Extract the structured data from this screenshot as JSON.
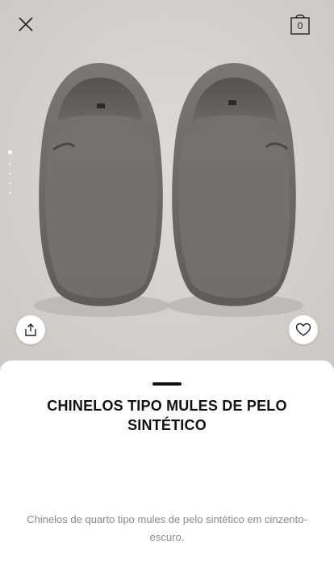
{
  "header": {
    "close_icon": "close-icon",
    "bag_icon": "shopping-bag-icon",
    "bag_count": "0"
  },
  "gallery": {
    "image_subject": "grey faux fur mule slippers",
    "dot_count": 5,
    "active_dot_index": 0
  },
  "actions": {
    "share_icon": "share-icon",
    "favorite_icon": "heart-icon"
  },
  "product": {
    "title": "CHINELOS TIPO MULES DE PELO SINTÉTICO",
    "description": "Chinelos de quarto tipo mules de pelo sintético em cinzento-escuro."
  },
  "colors": {
    "slipper": "#6f6c69",
    "background": "#d7d3cf",
    "text": "#111111",
    "muted_text": "#8a8a8a"
  }
}
